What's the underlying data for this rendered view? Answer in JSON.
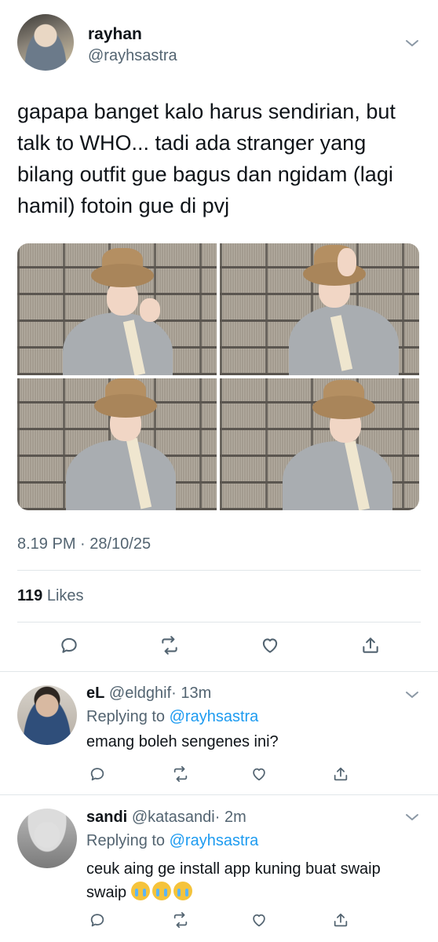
{
  "tweet": {
    "display_name": "rayhan",
    "handle": "@rayhsastra",
    "text": "gapapa banget kalo harus sendirian, but talk to WHO... tadi ada stranger yang bilang outfit gue bagus dan ngidam (lagi hamil) fotoin gue di pvj",
    "timestamp": "8.19 PM · 28/10/25",
    "likes_count": "119",
    "likes_label": "Likes",
    "photos": [
      "photo-1",
      "photo-2",
      "photo-3",
      "photo-4"
    ]
  },
  "replies": [
    {
      "display_name": "eL",
      "handle": "@eldghif",
      "time": "· 13m",
      "replying_label": "Replying to",
      "replying_to": "@rayhsastra",
      "text": "emang boleh sengenes ini?"
    },
    {
      "display_name": "sandi",
      "handle": "@katasandi",
      "time": "· 2m",
      "replying_label": "Replying to",
      "replying_to": "@rayhsastra",
      "text": "ceuk aing ge install app kuning buat swaip swaip",
      "emoji": [
        "loudly-crying-face",
        "loudly-crying-face",
        "loudly-crying-face"
      ]
    }
  ],
  "icons": {
    "reply": "reply-icon",
    "retweet": "retweet-icon",
    "like": "like-icon",
    "share": "share-icon",
    "more": "chevron-down-icon"
  },
  "colors": {
    "text": "#0f1419",
    "muted": "#536471",
    "link": "#1d9bf0",
    "divider": "#e1e6e9"
  }
}
